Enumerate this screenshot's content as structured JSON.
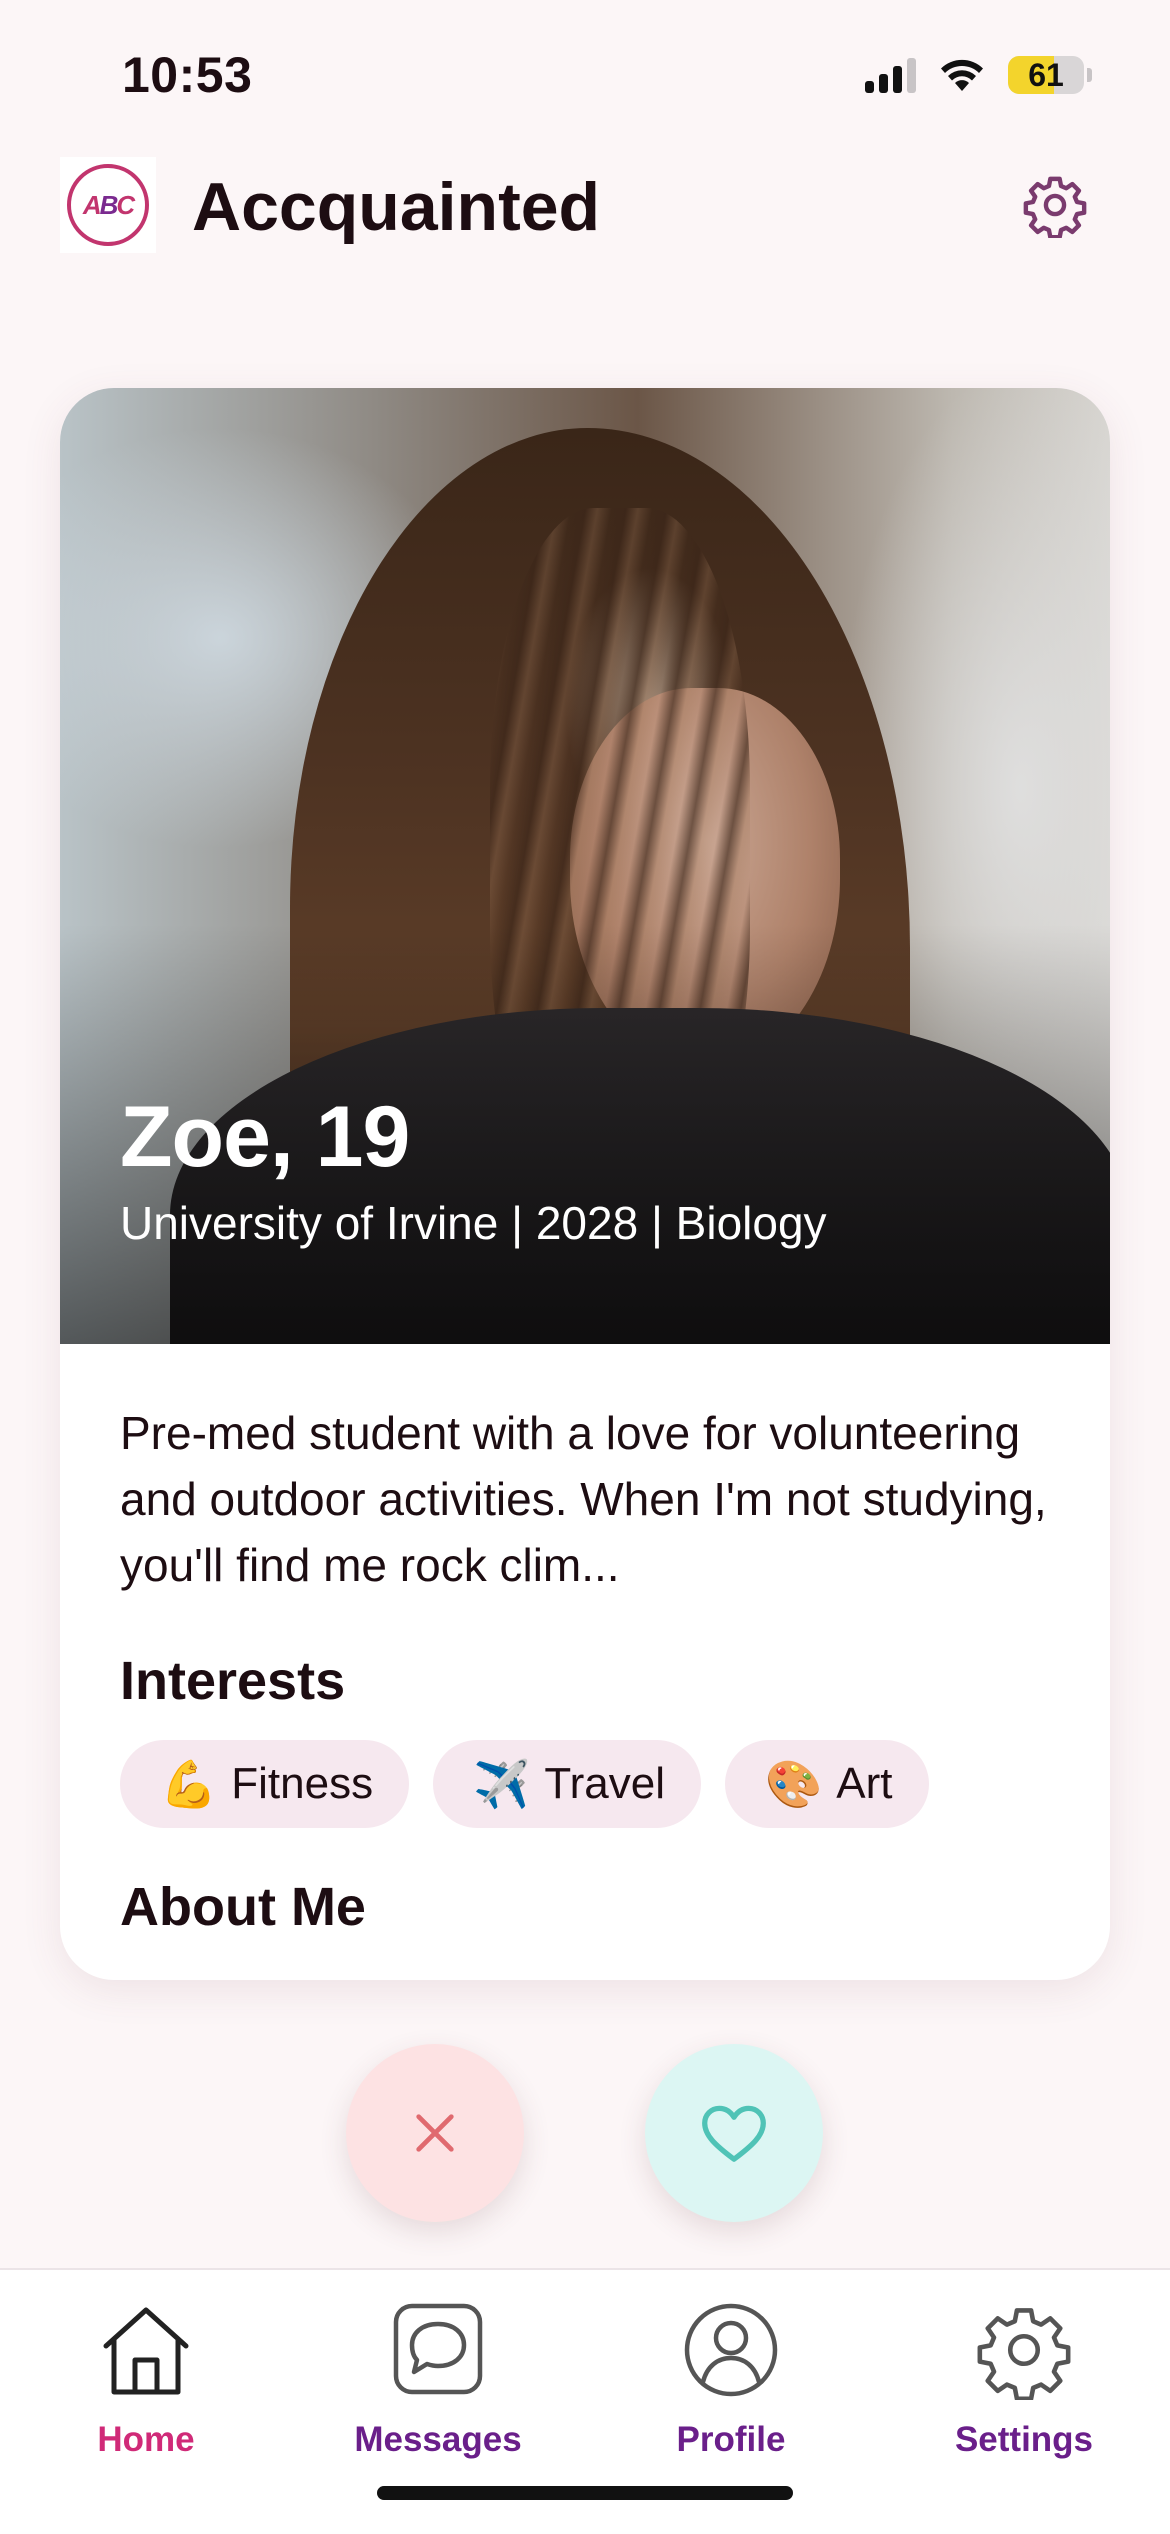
{
  "status_bar": {
    "time": "10:53",
    "battery_level": "61",
    "battery_fraction": 0.61,
    "signal_bars_active": 3,
    "signal_bars_total": 4,
    "icons": [
      "cellular-signal-icon",
      "wifi-icon",
      "battery-icon"
    ]
  },
  "header": {
    "app_title": "Accquainted",
    "logo_icon": "app-logo-icon",
    "settings_icon": "gear-icon"
  },
  "profile": {
    "name_age": "Zoe, 19",
    "meta": "University of Irvine | 2028 | Biology",
    "bio": "Pre-med student with a love for volunteering and outdoor activities. When I'm not studying, you'll find me rock clim...",
    "interests_title": "Interests",
    "interests": [
      {
        "emoji": "💪",
        "label": "Fitness"
      },
      {
        "emoji": "✈️",
        "label": "Travel"
      },
      {
        "emoji": "🎨",
        "label": "Art"
      }
    ],
    "about_title": "About Me"
  },
  "actions": {
    "pass_icon": "close-icon",
    "like_icon": "heart-icon"
  },
  "tabbar": {
    "items": [
      {
        "label": "Home",
        "icon": "home-icon",
        "active": true
      },
      {
        "label": "Messages",
        "icon": "message-bubble-icon",
        "active": false
      },
      {
        "label": "Profile",
        "icon": "person-icon",
        "active": false
      },
      {
        "label": "Settings",
        "icon": "gear-icon",
        "active": false
      }
    ]
  },
  "colors": {
    "background": "#fcf6f7",
    "title_text": "#1d0d12",
    "accent_active": "#d02a78",
    "accent_tab": "#6a1f8a",
    "chip_bg": "#f6e8ef",
    "pass_bg": "#fde2e3",
    "pass_icon": "#e06a6f",
    "like_bg": "#dcf6f3",
    "like_icon": "#4fc3b6",
    "header_gear": "#7a3b6e"
  }
}
